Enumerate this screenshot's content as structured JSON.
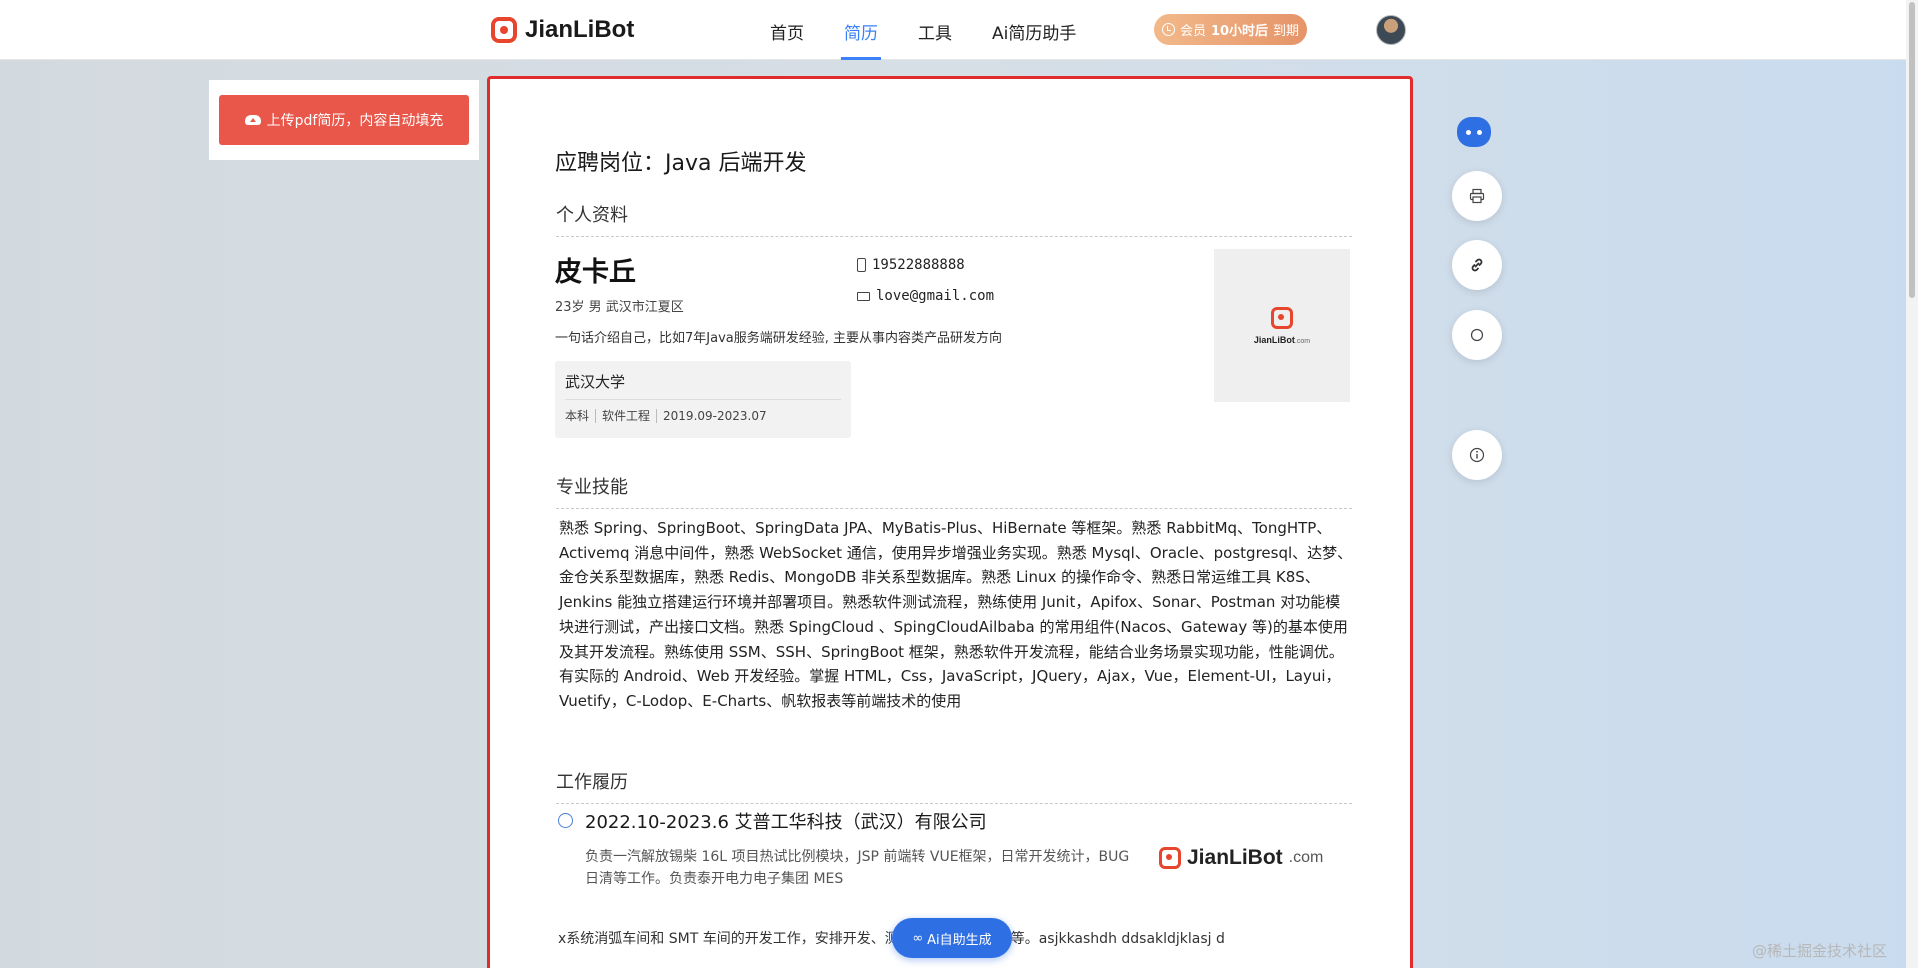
{
  "header": {
    "logo_text": "JianLiBot",
    "nav": [
      "首页",
      "简历",
      "工具",
      "Ai简历助手"
    ],
    "member_prefix": "会员",
    "member_time": "10小时后",
    "member_suffix": "到期"
  },
  "sidebar": {
    "upload_label": "上传pdf简历，内容自动填充"
  },
  "resume": {
    "title": "应聘岗位：Java 后端开发",
    "profile_heading": "个人资料",
    "name": "皮卡丘",
    "meta": "23岁 男 武汉市江夏区",
    "intro": "一句话介绍自己，比如7年Java服务端研发经验, 主要从事内容类产品研发方向",
    "phone": "19522888888",
    "email": "love@gmail.com",
    "photo_brand": "JianLiBot",
    "photo_brand_suffix": ".com",
    "education": {
      "school": "武汉大学",
      "degree": "本科",
      "major": "软件工程",
      "period": "2019.09-2023.07"
    },
    "skills_heading": "专业技能",
    "skills_text": "熟悉 Spring、SpringBoot、SpringData JPA、MyBatis-Plus、HiBernate 等框架。熟悉 RabbitMq、TongHTP、Activemq 消息中间件，熟悉 WebSocket 通信，使用异步增强业务实现。熟悉 Mysql、Oracle、postgresql、达梦、金仓关系型数据库，熟悉 Redis、MongoDB 非关系型数据库。熟悉 Linux 的操作命令、熟悉日常运维工具 K8S、Jenkins 能独立搭建运行环境并部署项目。熟悉软件测试流程，熟练使用 Junit，Apifox、Sonar、Postman 对功能模块进行测试，产出接口文档。熟悉 SpingCloud 、SpingCloudAilbaba 的常用组件(Nacos、Gateway 等)的基本使用及其开发流程。熟练使用 SSM、SSH、SpringBoot 框架，熟悉软件开发流程，能结合业务场景实现功能，性能调优。有实际的 Android、Web 开发经验。掌握 HTML，Css，JavaScript，JQuery，Ajax，Vue，Element-UI，Layui，Vuetify，C-Lodop、E-Charts、帆软报表等前端技术的使用",
    "work_heading": "工作履历",
    "work": {
      "title": "2022.10-2023.6 艾普工华科技（武汉）有限公司",
      "desc": "负责一汽解放锡柴 16L 项目热试比例模块，JSP 前端转 VUE框架，日常开发统计，BUG 日清等工作。负责泰开电力电子集团 MES",
      "logo_text": "JianLiBot",
      "logo_suffix": ".com",
      "extra": "x系统消弧车间和 SMT 车间的开发工作，安排开发、测试、运维项目周会等。asjkkashdh ddsakldjklasj d"
    }
  },
  "floating": {
    "ai_button": "Ai自助生成"
  },
  "watermark": "@稀土掘金技术社区",
  "colors": {
    "accent": "#3b82f6",
    "brand": "#e8452d",
    "upload": "#e8574a",
    "border_highlight": "#e02c2c"
  }
}
